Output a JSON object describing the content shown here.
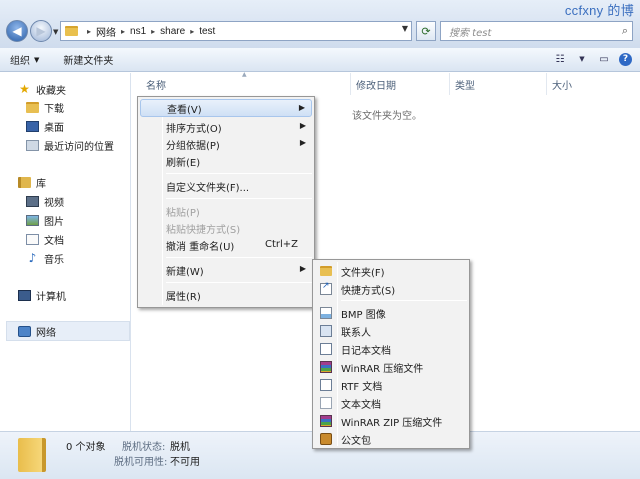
{
  "watermark": "ccfxny 的博",
  "address": {
    "breadcrumbs": [
      "网络",
      "ns1",
      "share",
      "test"
    ],
    "search_placeholder": "搜索 test"
  },
  "toolbar": {
    "organize": "组织",
    "new_folder": "新建文件夹"
  },
  "sidebar": {
    "favorites": "收藏夹",
    "downloads": "下载",
    "desktop": "桌面",
    "recent": "最近访问的位置",
    "libraries": "库",
    "videos": "视频",
    "pictures": "图片",
    "documents": "文档",
    "music": "音乐",
    "computer": "计算机",
    "network": "网络"
  },
  "columns": {
    "name": "名称",
    "modified": "修改日期",
    "type": "类型",
    "size": "大小"
  },
  "empty_message": "该文件夹为空。",
  "status": {
    "count": "0 个对象",
    "offline_status_label": "脱机状态:",
    "offline_status_value": "脱机",
    "offline_avail_label": "脱机可用性:",
    "offline_avail_value": "不可用"
  },
  "context_menu": {
    "view": "查看(V)",
    "sort": "排序方式(O)",
    "group": "分组依据(P)",
    "refresh": "刷新(E)",
    "customize": "自定义文件夹(F)...",
    "paste": "粘贴(P)",
    "paste_shortcut": "粘贴快捷方式(S)",
    "undo_rename": "撤消 重命名(U)",
    "undo_shortcut": "Ctrl+Z",
    "new": "新建(W)",
    "properties": "属性(R)"
  },
  "new_submenu": {
    "folder": "文件夹(F)",
    "shortcut": "快捷方式(S)",
    "bmp": "BMP 图像",
    "contact": "联系人",
    "notepad": "日记本文档",
    "winrar": "WinRAR 压缩文件",
    "rtf": "RTF 文档",
    "text": "文本文档",
    "winrar_zip": "WinRAR ZIP 压缩文件",
    "briefcase": "公文包"
  }
}
